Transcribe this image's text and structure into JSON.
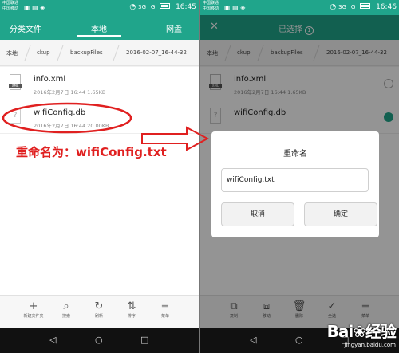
{
  "status": {
    "carrier1": "中国联通",
    "carrier2": "中国移动",
    "network": "3G",
    "signal": "G",
    "time_left": "16:45",
    "time_right": "16:46"
  },
  "left": {
    "tabs": [
      {
        "label": "分类文件"
      },
      {
        "label": "本地"
      },
      {
        "label": "网盘"
      }
    ],
    "breadcrumbs": [
      "本地",
      "ckup",
      "backupFiles",
      "2016-02-07_16-44-32"
    ],
    "files": [
      {
        "name": "info.xml",
        "meta": "2016年2月7日 16:44 1.65KB",
        "icon": "xml-file-icon",
        "icon_tag": "XML"
      },
      {
        "name": "wifiConfig.db",
        "meta": "2016年2月7日 16:44 20.00KB",
        "icon": "unknown-file-icon",
        "icon_tag": "?"
      }
    ],
    "annotation": "重命名为：wifiConfig.txt",
    "toolbar": [
      {
        "icon": "plus-icon",
        "glyph": "+",
        "label": "新建文件夹"
      },
      {
        "icon": "search-icon",
        "glyph": "⌕",
        "label": "搜索"
      },
      {
        "icon": "refresh-icon",
        "glyph": "↻",
        "label": "刷新"
      },
      {
        "icon": "sort-icon",
        "glyph": "⇅",
        "label": "排序"
      },
      {
        "icon": "menu-icon",
        "glyph": "≡",
        "label": "菜单"
      }
    ]
  },
  "right": {
    "title": "已选择",
    "selected_count": "1",
    "breadcrumbs": [
      "本地",
      "ckup",
      "backupFiles",
      "2016-02-07_16-44-32"
    ],
    "files": [
      {
        "name": "info.xml",
        "meta": "2016年2月7日 16:44 1.65KB",
        "icon_tag": "XML"
      },
      {
        "name": "wifiConfig.db",
        "meta": "",
        "icon_tag": "?"
      }
    ],
    "dialog": {
      "title": "重命名",
      "input_value": "wifiConfig.txt",
      "cancel_label": "取消",
      "ok_label": "确定"
    },
    "toolbar": [
      {
        "icon": "copy-icon",
        "glyph": "⧉",
        "label": "复制"
      },
      {
        "icon": "move-icon",
        "glyph": "⧈",
        "label": "移动"
      },
      {
        "icon": "delete-icon",
        "glyph": "🗑",
        "label": "删除"
      },
      {
        "icon": "select-all-icon",
        "glyph": "✓",
        "label": "全选"
      },
      {
        "icon": "menu-icon",
        "glyph": "≡",
        "label": "菜单"
      }
    ]
  },
  "nav": {
    "back": "◁",
    "home": "○",
    "recent": "□"
  },
  "watermark": {
    "brand": "Bai❀经验",
    "url": "jingyan.baidu.com"
  },
  "colors": {
    "accent": "#20a58b",
    "annotation": "#e02020"
  }
}
